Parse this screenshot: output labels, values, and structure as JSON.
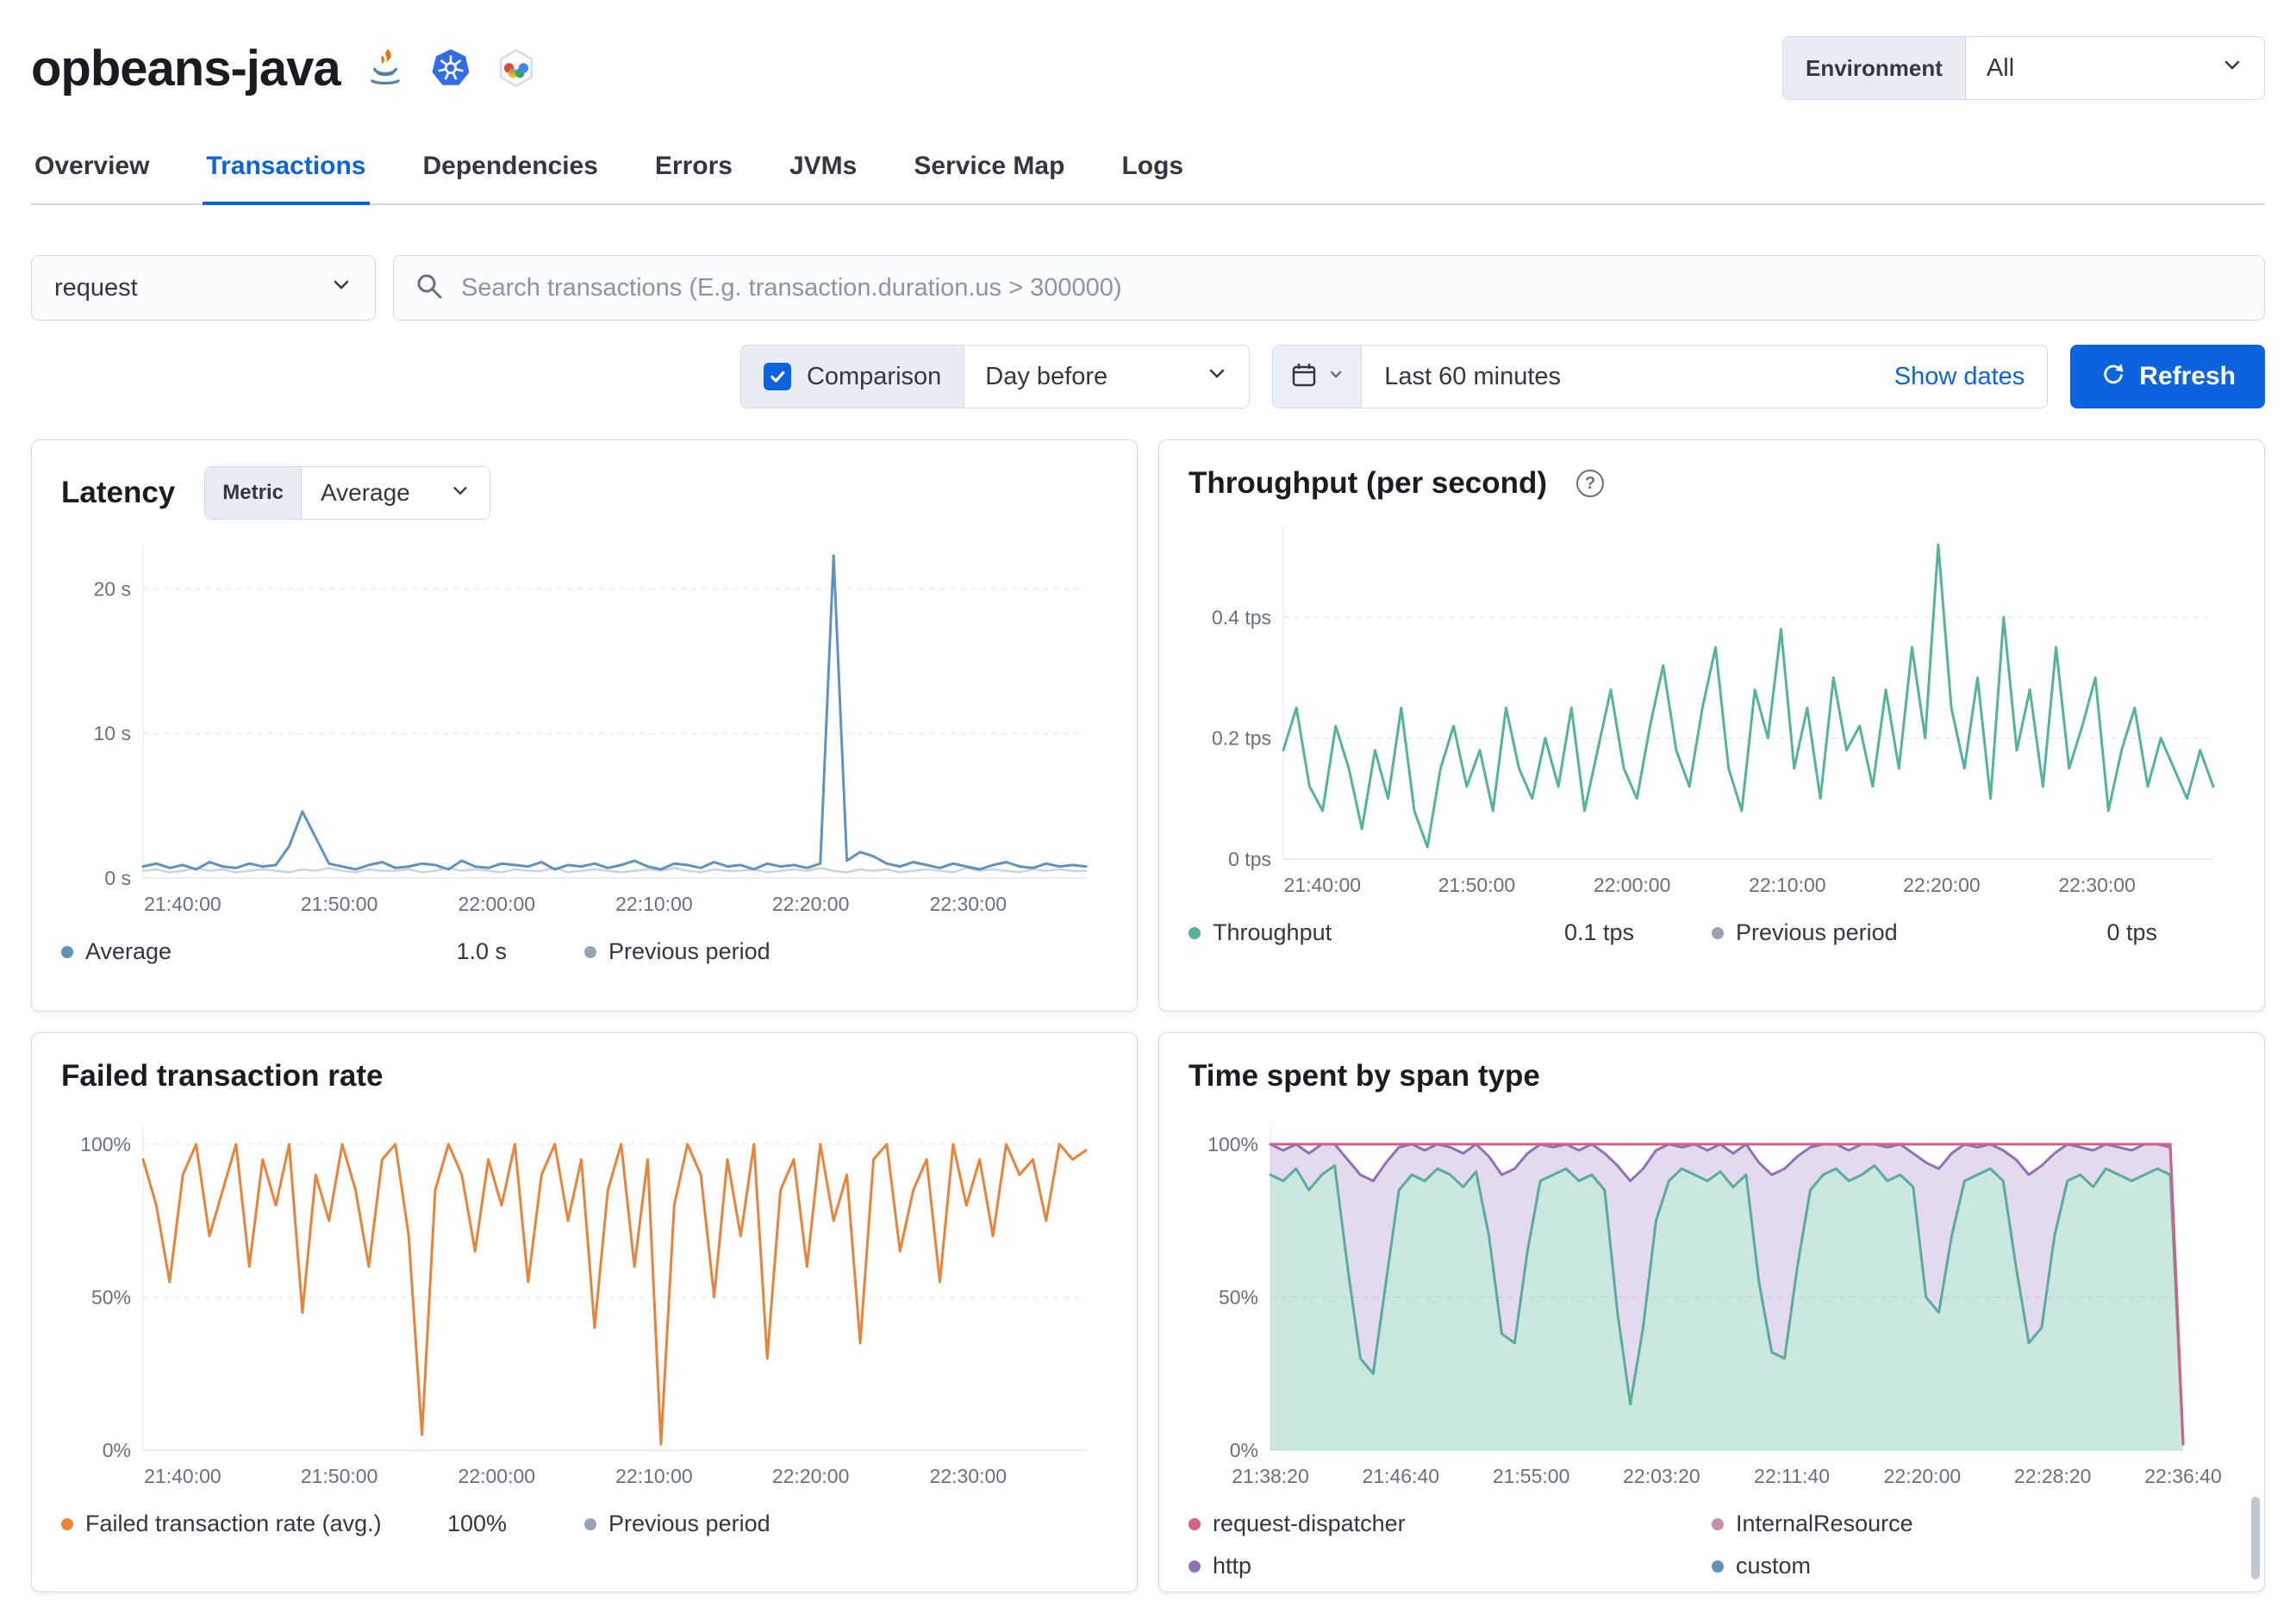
{
  "header": {
    "service_name": "opbeans-java",
    "environment_label": "Environment",
    "environment_value": "All",
    "agent_icons": [
      "java-icon",
      "kubernetes-icon",
      "google-cloud-icon"
    ]
  },
  "tabs": [
    {
      "label": "Overview",
      "active": false
    },
    {
      "label": "Transactions",
      "active": true
    },
    {
      "label": "Dependencies",
      "active": false
    },
    {
      "label": "Errors",
      "active": false
    },
    {
      "label": "JVMs",
      "active": false
    },
    {
      "label": "Service Map",
      "active": false
    },
    {
      "label": "Logs",
      "active": false
    }
  ],
  "filters": {
    "transaction_type_value": "request",
    "search_placeholder": "Search transactions (E.g. transaction.duration.us > 300000)",
    "comparison_label": "Comparison",
    "comparison_checked": true,
    "comparison_value": "Day before",
    "time_range_value": "Last 60 minutes",
    "show_dates_label": "Show dates",
    "refresh_label": "Refresh"
  },
  "panels": {
    "latency": {
      "title": "Latency",
      "metric_label": "Metric",
      "metric_value": "Average",
      "legend": [
        {
          "label": "Average",
          "value": "1.0 s",
          "color": "#6092C0"
        },
        {
          "label": "Previous period",
          "value": "",
          "color": "#98A2B3"
        }
      ]
    },
    "throughput": {
      "title": "Throughput (per second)",
      "legend": [
        {
          "label": "Throughput",
          "value": "0.1 tps",
          "color": "#54B399"
        },
        {
          "label": "Previous period",
          "value": "0 tps",
          "color": "#98A2B3"
        }
      ]
    },
    "failed_rate": {
      "title": "Failed transaction rate",
      "legend": [
        {
          "label": "Failed transaction rate (avg.)",
          "value": "100%",
          "color": "#E8833A"
        },
        {
          "label": "Previous period",
          "value": "",
          "color": "#98A2B3"
        }
      ]
    },
    "span_type": {
      "title": "Time spent by span type",
      "legend": [
        {
          "label": "request-dispatcher",
          "color": "#D36086"
        },
        {
          "label": "InternalResource",
          "color": "#CA8EAE"
        },
        {
          "label": "http",
          "color": "#9170B8"
        },
        {
          "label": "custom",
          "color": "#6092C0"
        }
      ]
    }
  },
  "chart_data": [
    {
      "id": "latency",
      "type": "line",
      "title": "Latency",
      "ylabel": "seconds",
      "y_max": 23,
      "pad_left": 95,
      "pad_right": 25,
      "y_ticks": [
        {
          "value": 0,
          "label": "0 s"
        },
        {
          "value": 10,
          "label": "10 s"
        },
        {
          "value": 20,
          "label": "20 s"
        }
      ],
      "x_labels": [
        "21:40:00",
        "21:50:00",
        "22:00:00",
        "22:10:00",
        "22:20:00",
        "22:30:00"
      ],
      "x_fractions": [
        0.042,
        0.208,
        0.375,
        0.542,
        0.708,
        0.875
      ],
      "series": [
        {
          "name": "Previous period",
          "color": "#cbd3de",
          "width": 2.5,
          "values": [
            0.5,
            0.6,
            0.4,
            0.5,
            0.7,
            0.5,
            0.6,
            0.4,
            0.5,
            0.6,
            0.5,
            0.4,
            0.6,
            0.5,
            0.7,
            0.5,
            0.4,
            0.6,
            0.5,
            0.5,
            0.6,
            0.4,
            0.5,
            0.7,
            0.5,
            0.6,
            0.5,
            0.4,
            0.6,
            0.5,
            0.5,
            0.7,
            0.4,
            0.5,
            0.6,
            0.5,
            0.4,
            0.5,
            0.6,
            0.5,
            0.7,
            0.5,
            0.4,
            0.6,
            0.5,
            0.5,
            0.6,
            0.4,
            0.5,
            0.6,
            0.5,
            0.7,
            0.5,
            0.4,
            0.6,
            0.5,
            0.6,
            0.4,
            0.5,
            0.6,
            0.5,
            0.4,
            0.7,
            0.5,
            0.6,
            0.5,
            0.4,
            0.6,
            0.5,
            0.6,
            0.5,
            0.5
          ]
        },
        {
          "name": "Average",
          "color": "#6092C0",
          "width": 3,
          "values": [
            0.8,
            1.0,
            0.7,
            0.9,
            0.6,
            1.1,
            0.8,
            0.7,
            1.0,
            0.8,
            0.9,
            2.2,
            4.6,
            2.8,
            1.0,
            0.8,
            0.6,
            0.9,
            1.1,
            0.7,
            0.8,
            1.0,
            0.9,
            0.6,
            1.2,
            0.8,
            0.7,
            1.0,
            0.9,
            0.8,
            1.1,
            0.6,
            0.9,
            0.8,
            1.0,
            0.7,
            0.9,
            1.2,
            0.8,
            0.6,
            1.0,
            0.9,
            0.7,
            1.1,
            0.8,
            0.9,
            0.6,
            1.0,
            0.8,
            0.9,
            0.7,
            1.0,
            22.3,
            1.2,
            1.8,
            1.5,
            1.0,
            0.8,
            1.1,
            0.9,
            0.7,
            1.0,
            0.8,
            0.6,
            0.9,
            1.1,
            0.8,
            0.7,
            1.0,
            0.8,
            0.9,
            0.8
          ]
        }
      ]
    },
    {
      "id": "throughput",
      "type": "line",
      "title": "Throughput (per second)",
      "ylabel": "tps",
      "y_max": 0.55,
      "pad_left": 110,
      "pad_right": 25,
      "y_ticks": [
        {
          "value": 0,
          "label": "0 tps"
        },
        {
          "value": 0.2,
          "label": "0.2 tps"
        },
        {
          "value": 0.4,
          "label": "0.4 tps"
        }
      ],
      "x_labels": [
        "21:40:00",
        "21:50:00",
        "22:00:00",
        "22:10:00",
        "22:20:00",
        "22:30:00"
      ],
      "x_fractions": [
        0.042,
        0.208,
        0.375,
        0.542,
        0.708,
        0.875
      ],
      "series": [
        {
          "name": "Previous period",
          "color": "#cbd3de",
          "width": 2.5,
          "values": []
        },
        {
          "name": "Throughput",
          "color": "#54B399",
          "width": 3,
          "values": [
            0.18,
            0.25,
            0.12,
            0.08,
            0.22,
            0.15,
            0.05,
            0.18,
            0.1,
            0.25,
            0.08,
            0.02,
            0.15,
            0.22,
            0.12,
            0.18,
            0.08,
            0.25,
            0.15,
            0.1,
            0.2,
            0.12,
            0.25,
            0.08,
            0.18,
            0.28,
            0.15,
            0.1,
            0.22,
            0.32,
            0.18,
            0.12,
            0.25,
            0.35,
            0.15,
            0.08,
            0.28,
            0.2,
            0.38,
            0.15,
            0.25,
            0.1,
            0.3,
            0.18,
            0.22,
            0.12,
            0.28,
            0.15,
            0.35,
            0.2,
            0.52,
            0.25,
            0.15,
            0.3,
            0.1,
            0.4,
            0.18,
            0.28,
            0.12,
            0.35,
            0.15,
            0.22,
            0.3,
            0.08,
            0.18,
            0.25,
            0.12,
            0.2,
            0.15,
            0.1,
            0.18,
            0.12
          ]
        }
      ]
    },
    {
      "id": "failed_rate",
      "type": "line",
      "title": "Failed transaction rate",
      "ylabel": "percent",
      "y_max": 107,
      "pad_left": 95,
      "pad_right": 25,
      "y_ticks": [
        {
          "value": 0,
          "label": "0%"
        },
        {
          "value": 50,
          "label": "50%"
        },
        {
          "value": 100,
          "label": "100%"
        }
      ],
      "x_labels": [
        "21:40:00",
        "21:50:00",
        "22:00:00",
        "22:10:00",
        "22:20:00",
        "22:30:00"
      ],
      "x_fractions": [
        0.042,
        0.208,
        0.375,
        0.542,
        0.708,
        0.875
      ],
      "series": [
        {
          "name": "Previous period",
          "color": "#cbd3de",
          "width": 2.5,
          "values": []
        },
        {
          "name": "Failed transaction rate (avg.)",
          "color": "#E8833A",
          "width": 3,
          "values": [
            95,
            80,
            55,
            90,
            100,
            70,
            85,
            100,
            60,
            95,
            80,
            100,
            45,
            90,
            75,
            100,
            85,
            60,
            95,
            100,
            70,
            5,
            85,
            100,
            90,
            65,
            95,
            80,
            100,
            55,
            90,
            100,
            75,
            95,
            40,
            85,
            100,
            60,
            95,
            2,
            80,
            100,
            90,
            50,
            95,
            70,
            100,
            30,
            85,
            95,
            60,
            100,
            75,
            90,
            35,
            95,
            100,
            65,
            85,
            95,
            55,
            100,
            80,
            95,
            70,
            100,
            90,
            95,
            75,
            100,
            95,
            98
          ]
        }
      ]
    },
    {
      "id": "span_type",
      "type": "area",
      "title": "Time spent by span type",
      "ylabel": "percent",
      "y_max": 1.07,
      "pad_left": 95,
      "pad_right": 60,
      "y_ticks": [
        {
          "value": 0,
          "label": "0%"
        },
        {
          "value": 0.5,
          "label": "50%"
        },
        {
          "value": 1,
          "label": "100%"
        }
      ],
      "x_labels": [
        "21:38:20",
        "21:46:40",
        "21:55:00",
        "22:03:20",
        "22:11:40",
        "22:20:00",
        "22:28:20",
        "22:36:40"
      ],
      "x_fractions": [
        0,
        0.1429,
        0.2857,
        0.4286,
        0.5714,
        0.7143,
        0.8571,
        1
      ],
      "series": [
        {
          "name": "custom",
          "color": "#54B399",
          "width": 3,
          "fill": "#54B399",
          "fill_opacity": 0.3,
          "base": "zero",
          "values": [
            0.9,
            0.88,
            0.92,
            0.85,
            0.9,
            0.93,
            0.6,
            0.3,
            0.25,
            0.55,
            0.85,
            0.9,
            0.88,
            0.92,
            0.9,
            0.86,
            0.91,
            0.7,
            0.38,
            0.35,
            0.65,
            0.88,
            0.9,
            0.92,
            0.88,
            0.9,
            0.85,
            0.45,
            0.15,
            0.4,
            0.75,
            0.88,
            0.92,
            0.9,
            0.88,
            0.91,
            0.86,
            0.9,
            0.55,
            0.32,
            0.3,
            0.6,
            0.85,
            0.9,
            0.92,
            0.88,
            0.9,
            0.93,
            0.88,
            0.9,
            0.86,
            0.5,
            0.45,
            0.7,
            0.88,
            0.9,
            0.92,
            0.88,
            0.6,
            0.35,
            0.4,
            0.7,
            0.88,
            0.9,
            0.86,
            0.92,
            0.9,
            0.88,
            0.9,
            0.92,
            0.9,
            0.02
          ]
        },
        {
          "name": "http",
          "color": "#9170B8",
          "width": 3,
          "fill": "#9170B8",
          "fill_opacity": 0.25,
          "base_index": 0,
          "values": [
            1.0,
            0.98,
            1.0,
            0.97,
            1.0,
            1.0,
            0.95,
            0.9,
            0.88,
            0.94,
            0.99,
            1.0,
            0.98,
            1.0,
            0.99,
            0.97,
            1.0,
            0.96,
            0.9,
            0.92,
            0.97,
            1.0,
            0.99,
            1.0,
            0.98,
            1.0,
            0.97,
            0.93,
            0.88,
            0.92,
            0.98,
            1.0,
            0.99,
            1.0,
            0.98,
            1.0,
            0.97,
            1.0,
            0.94,
            0.9,
            0.92,
            0.96,
            0.99,
            1.0,
            1.0,
            0.98,
            1.0,
            1.0,
            0.99,
            1.0,
            0.97,
            0.94,
            0.92,
            0.97,
            1.0,
            0.99,
            1.0,
            0.98,
            0.95,
            0.9,
            0.93,
            0.97,
            1.0,
            0.99,
            0.98,
            1.0,
            0.99,
            0.98,
            1.0,
            1.0,
            0.99,
            0.02
          ]
        },
        {
          "name": "request-dispatcher",
          "color": "#D36086",
          "width": 3,
          "values": [
            1,
            1,
            1,
            1,
            1,
            1,
            1,
            1,
            1,
            1,
            1,
            1,
            1,
            1,
            1,
            1,
            1,
            1,
            1,
            1,
            1,
            1,
            1,
            1,
            1,
            1,
            1,
            1,
            1,
            1,
            1,
            1,
            1,
            1,
            1,
            1,
            1,
            1,
            1,
            1,
            1,
            1,
            1,
            1,
            1,
            1,
            1,
            1,
            1,
            1,
            1,
            1,
            1,
            1,
            1,
            1,
            1,
            1,
            1,
            1,
            1,
            1,
            1,
            1,
            1,
            1,
            1,
            1,
            1,
            1,
            1,
            0.02
          ]
        }
      ]
    }
  ]
}
